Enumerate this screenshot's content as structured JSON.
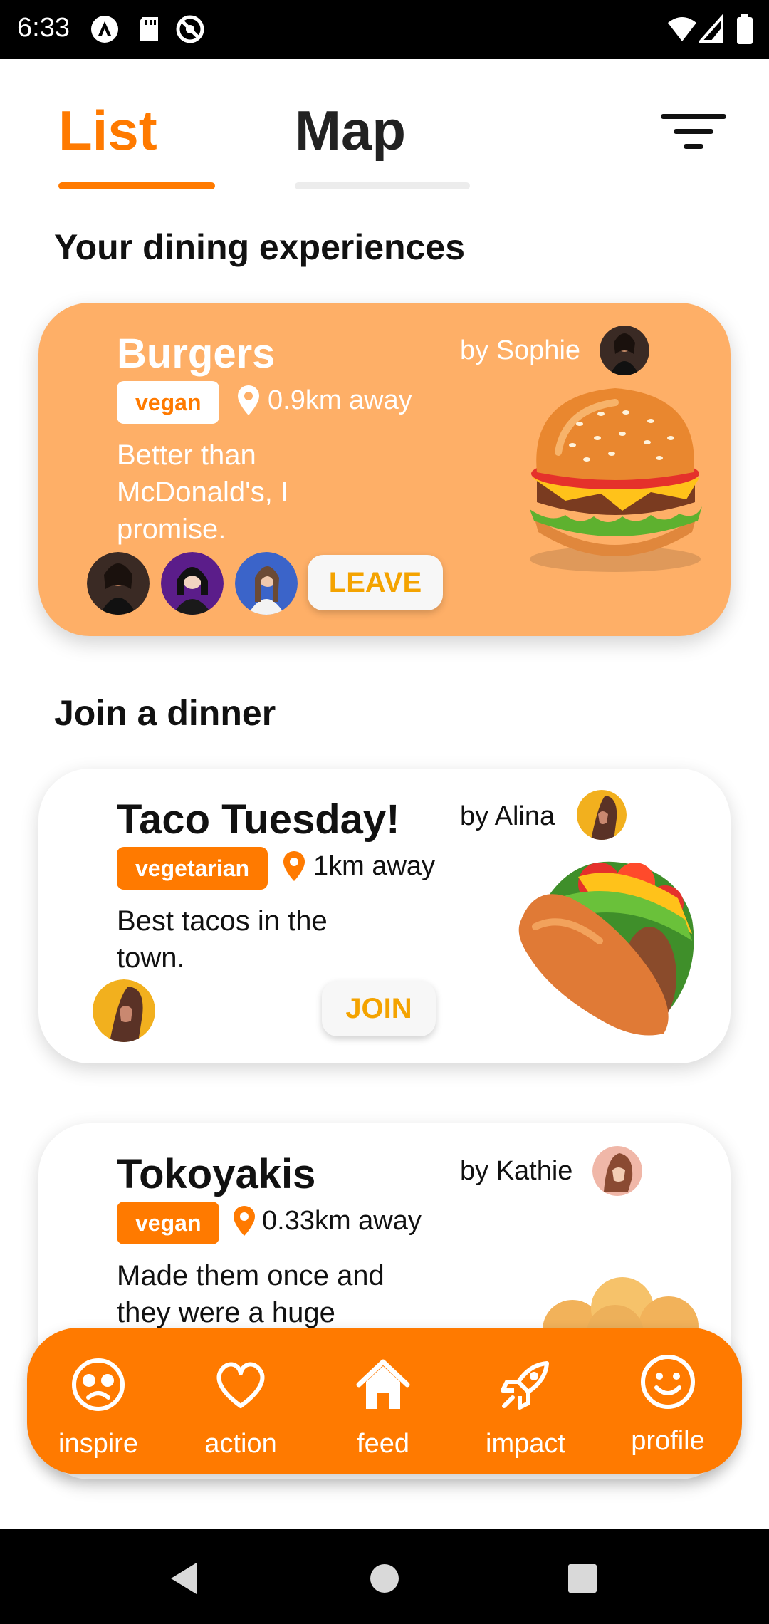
{
  "status_bar": {
    "time": "6:33"
  },
  "tabs": [
    {
      "label": "List",
      "active": true
    },
    {
      "label": "Map",
      "active": false
    }
  ],
  "sections": {
    "mine": "Your dining experiences",
    "join": "Join a dinner"
  },
  "cards": [
    {
      "title": "Burgers",
      "host": "by Sophie",
      "tag": "vegan",
      "distance": "0.9km away",
      "description": "Better than McDonald's, I promise.",
      "action": "LEAVE",
      "participants": 3
    },
    {
      "title": "Taco Tuesday!",
      "host": "by Alina",
      "tag": "vegetarian",
      "distance": "1km away",
      "description": "Best tacos in the town.",
      "action": "JOIN",
      "participants": 1
    },
    {
      "title": "Tokoyakis",
      "host": "by Kathie",
      "tag": "vegan",
      "distance": "0.33km away",
      "description": "Made them once and they were a huge"
    }
  ],
  "bottom_nav": [
    {
      "label": "inspire",
      "icon": "inspire-face-icon"
    },
    {
      "label": "action",
      "icon": "heart-icon"
    },
    {
      "label": "feed",
      "icon": "home-icon"
    },
    {
      "label": "impact",
      "icon": "rocket-icon"
    },
    {
      "label": "profile",
      "icon": "smiley-icon"
    }
  ],
  "colors": {
    "accent": "#ff7a00",
    "card_orange": "#feaf67",
    "button_text": "#f4a300"
  }
}
